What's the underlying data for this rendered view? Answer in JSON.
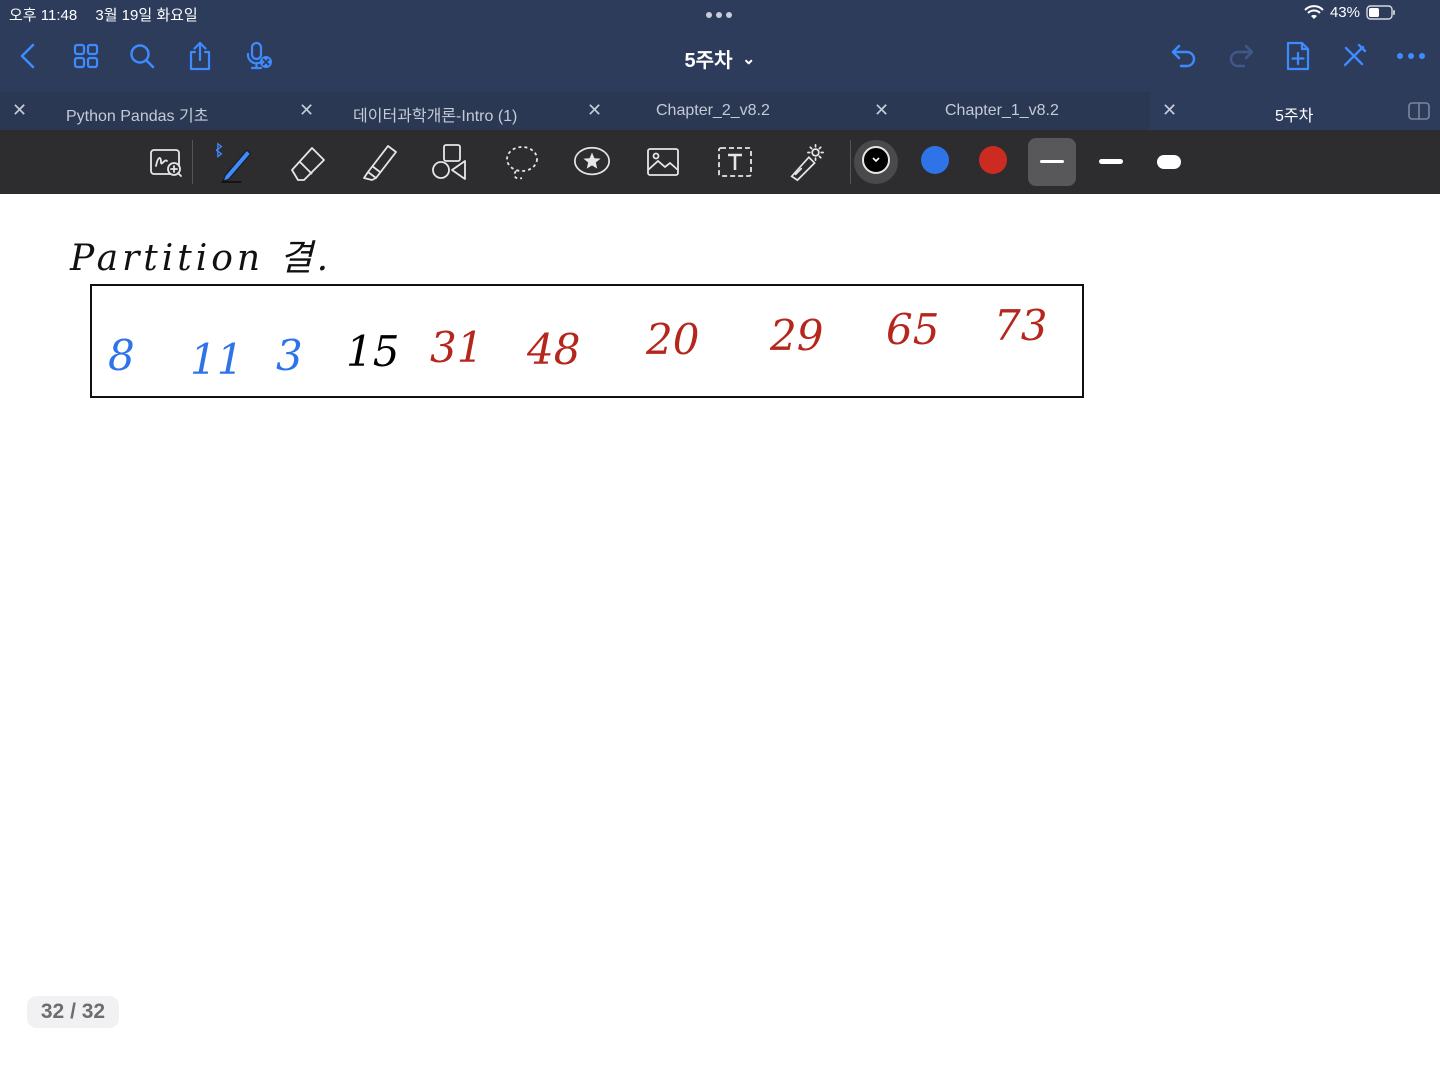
{
  "status_bar": {
    "time": "오후 11:48",
    "date": "3월 19일 화요일",
    "battery": "43%"
  },
  "header": {
    "title": "5주차",
    "title_chevron": "⌄"
  },
  "tabs": [
    {
      "label": "Python  Pandas 기초",
      "active": false
    },
    {
      "label": "데이터과학개론-Intro (1)",
      "active": false
    },
    {
      "label": "Chapter_2_v8.2",
      "active": false
    },
    {
      "label": "Chapter_1_v8.2",
      "active": false
    },
    {
      "label": "5주차",
      "active": true
    }
  ],
  "toolbar": {
    "colors": [
      "#000000",
      "#2f73e8",
      "#cc2b22"
    ],
    "selected_color": "#000000"
  },
  "note": {
    "heading": "Partition 결.",
    "numbers": [
      {
        "value": "8",
        "color": "#2f73e8"
      },
      {
        "value": "11",
        "color": "#2f73e8"
      },
      {
        "value": "3",
        "color": "#2f73e8"
      },
      {
        "value": "15",
        "color": "#000000"
      },
      {
        "value": "31",
        "color": "#b5261c"
      },
      {
        "value": "48",
        "color": "#b5261c"
      },
      {
        "value": "20",
        "color": "#b5261c"
      },
      {
        "value": "29",
        "color": "#b5261c"
      },
      {
        "value": "65",
        "color": "#b5261c"
      },
      {
        "value": "73",
        "color": "#b5261c"
      }
    ]
  },
  "page_indicator": "32 / 32"
}
